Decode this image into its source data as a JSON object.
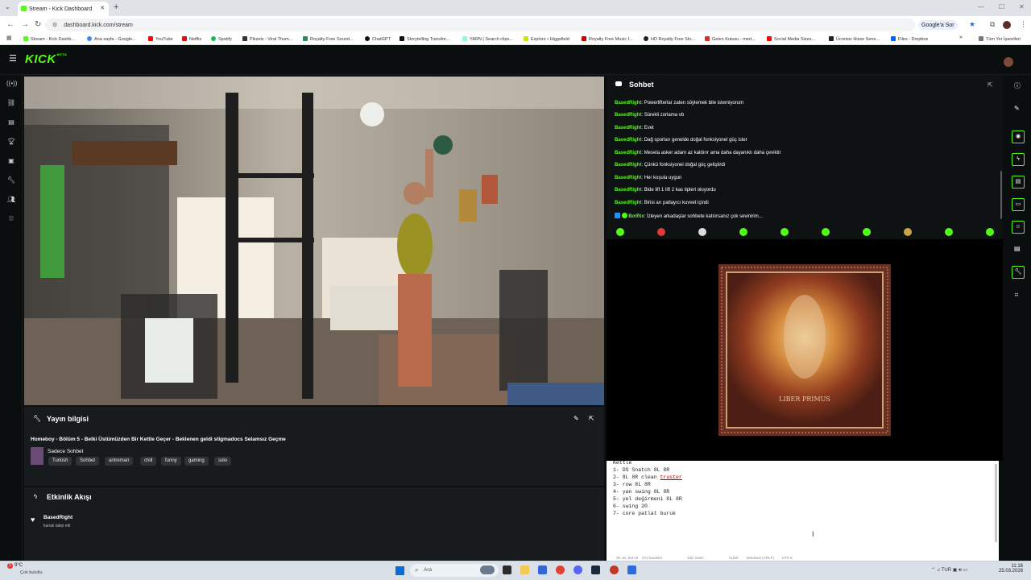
{
  "browser": {
    "tab_title": "Stream - Kick Dashboard",
    "url": "dashboard.kick.com/stream",
    "google_sor": "Google'a Sor",
    "bookmarks": [
      "Stream - Kick Dashb...",
      "Ana sayfa - Google...",
      "YouTube",
      "Netflix",
      "Spotify",
      "Pikzels - Viral Thum...",
      "Royalty-Free Sound...",
      "ChatGPT",
      "Storytelling Transfor...",
      "YARN | Search clips...",
      "Explore • Higgsfield",
      "Royalty Free Music f...",
      "HD Royalty Free Sto...",
      "Gelen Kutusu - mert...",
      "Social Media Sizes...",
      "Ücretsiz Hisse Sene...",
      "Files - Dropbox"
    ],
    "all_bookmarks": "Tüm Yer İşaretleri",
    "colors": {
      "accent": "#53fc18",
      "bg": "#0b0e0f",
      "panel": "#181b1d"
    }
  },
  "kick": {
    "logo": "KICK",
    "logo_badge": "BETA",
    "info_panel": {
      "title": "Yayın bilgisi",
      "stream_title": "Homeboy - Bölüm 5 - Belki Üstümüzden Bir Kettle Geçer - Beklenen geldi stigmadocs Selamsız Geçme",
      "category": "Sadece Sohbet",
      "tags": [
        "Turkish",
        "Sohbet",
        "antreman",
        "chill",
        "funny",
        "gaming",
        "solo"
      ]
    },
    "activity_panel": {
      "title": "Etkinlik Akışı",
      "events": [
        {
          "user": "BasedRight",
          "text": "kanalı takip etti"
        }
      ]
    },
    "chat": {
      "title": "Sohbet",
      "messages": [
        {
          "user": "BasedRight",
          "text": "Powerlifterlar zaten söylemek bile istemiyorum"
        },
        {
          "user": "BasedRight",
          "text": "Sürekli zorlama vb"
        },
        {
          "user": "BasedRight",
          "text": "Evet"
        },
        {
          "user": "BasedRight",
          "text": "Dağ sporları genelde doğal fonksiyonel güç ister"
        },
        {
          "user": "BasedRight",
          "text": "Mesela asker adam az kaldırır ama daha dayanıklı daha çeviktir"
        },
        {
          "user": "BasedRight",
          "text": "Çünkü fonksiyonel doğal güç geliştirdi"
        },
        {
          "user": "BasedRight",
          "text": "Her koşula uygun"
        },
        {
          "user": "BasedRight",
          "text": "Bide lift 1 lift 2 kas tipleri oluyordu"
        },
        {
          "user": "BasedRight",
          "text": "Birisi arı patlayıcı kuvvet içindi"
        }
      ],
      "bot_message": {
        "user": "BotRix",
        "text": "İzleyen arkadaşlar sohbete katılırsanız çok sevinirim..."
      }
    },
    "album": {
      "title": "LIBER PRIMUS"
    }
  },
  "notepad": {
    "lines": [
      "Kettle",
      "1- DS Snatch 8L 8R",
      "2- 8L 8R clean ",
      "3- row 8L 8R",
      "4- yan swing 8L 8R",
      "5- yel değirmeni 8L 8R",
      "6- swing 20",
      "7- core patlat buruk"
    ],
    "misspelled_word": "truster",
    "status": "Sh 18, Süt 23    572 karakter                         Düz metin                         %100        Windows (CRLF)        UTF-8"
  },
  "taskbar": {
    "temp": "9°C",
    "weather": "Çok bulutlu",
    "search_placeholder": "Ara",
    "lang": "TUR",
    "time": "11:16",
    "date": "25.03.2026",
    "notif_count": "1"
  }
}
